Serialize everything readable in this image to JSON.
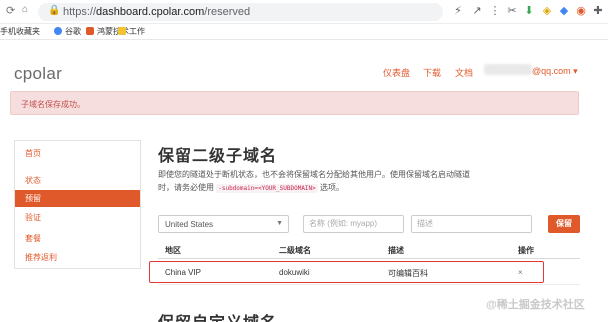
{
  "browser": {
    "url_scheme": "https://",
    "url_host": "dashboard.cpolar.com",
    "url_path": "/reserved",
    "bookmarks": [
      {
        "label": "手机收藏夹",
        "color": "#ffffff"
      },
      {
        "label": "谷歌",
        "color": "#4285f4"
      },
      {
        "label": "鸿蒙技术",
        "color": "#e0592a"
      },
      {
        "label": "工作",
        "color": "#f4c430"
      }
    ]
  },
  "header": {
    "logo": "cpolar",
    "nav": [
      "仪表盘",
      "下载",
      "文档"
    ],
    "email": "@qq.com ▾"
  },
  "alert": {
    "text": "子域名保存成功。"
  },
  "sidebar": {
    "items": [
      {
        "label": "首页",
        "active": false
      },
      {
        "label": "状态",
        "active": false
      },
      {
        "label": "预留",
        "active": true
      },
      {
        "label": "验证",
        "active": false
      },
      {
        "label": "套餐",
        "active": false
      },
      {
        "label": "推荐返利",
        "active": false
      }
    ]
  },
  "main": {
    "title": "保留二级子域名",
    "desc_before": "即使您的隧道处于断机状态，也不会将保留域名分配给其他用户。使用保留域名启动隧道时，请务必使用",
    "desc_code": "-subdomain=<YOUR_SUBDOMAIN>",
    "desc_after": "选项。",
    "form": {
      "region_value": "United States",
      "name_placeholder": "名称 (例如: myapp)",
      "desc_placeholder": "描述",
      "save_label": "保留"
    },
    "table": {
      "headers": [
        "地区",
        "二级域名",
        "描述",
        "操作"
      ],
      "rows": [
        {
          "region": "China VIP",
          "subdomain": "dokuwiki",
          "description": "可编辑百科",
          "action": "×"
        }
      ]
    },
    "next_title": "保留自定义域名"
  },
  "watermark": "@稀土掘金技术社区"
}
